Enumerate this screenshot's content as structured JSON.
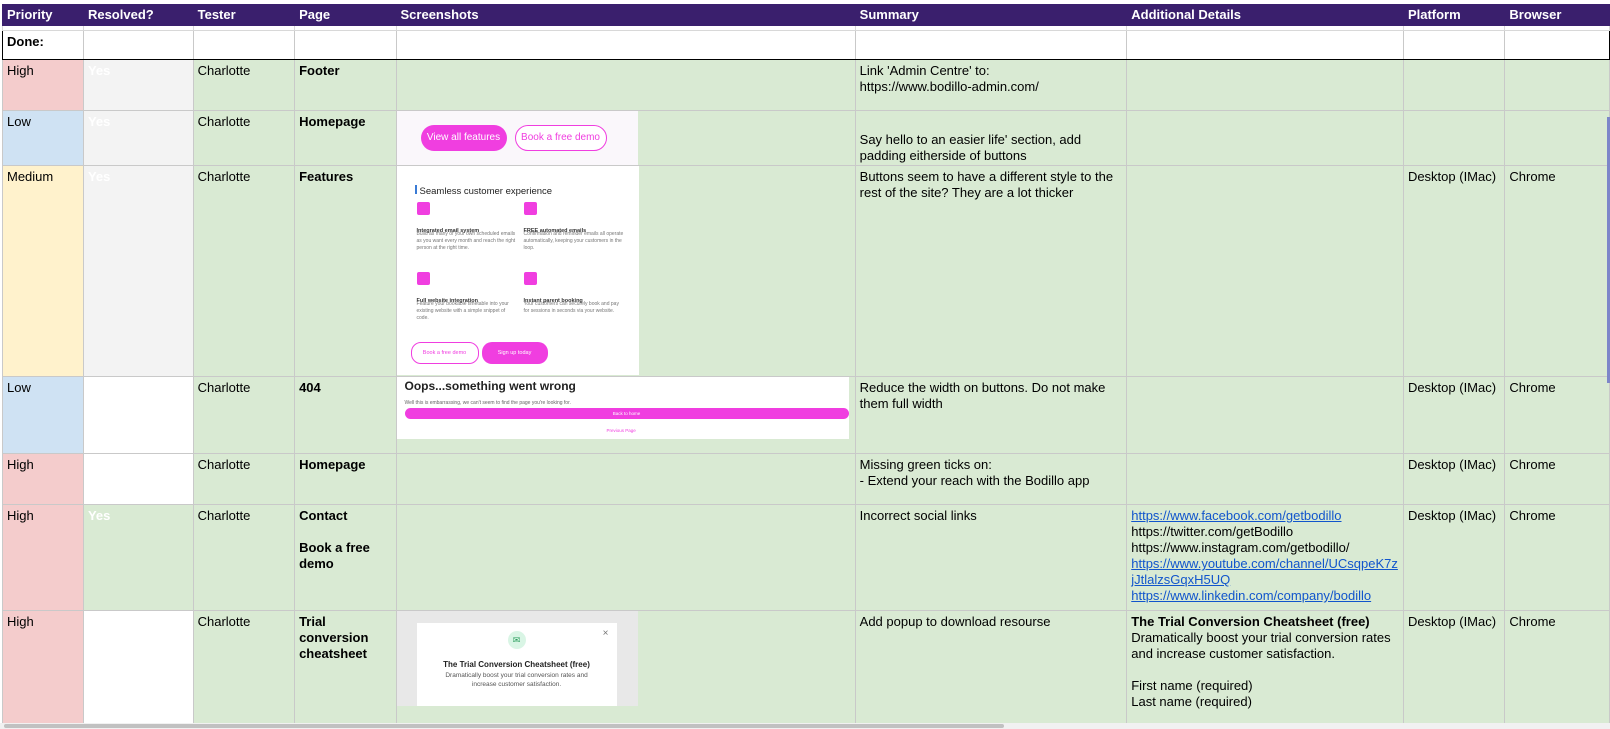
{
  "columns": [
    "Priority",
    "Resolved?",
    "Tester",
    "Page",
    "Screenshots",
    "Summary",
    "Additional Details",
    "Platform",
    "Browser"
  ],
  "done_label": "Done:",
  "colors": {
    "header_bg": "#3a1f6d",
    "row_green": "#d9ead3",
    "priority_high": "#f4cccc",
    "priority_low": "#cfe2f3",
    "priority_medium": "#fff2cc",
    "resolved_grey": "#f3f3f3",
    "link": "#1155cc",
    "brand_pink": "#f03ee0"
  },
  "rows": [
    {
      "priority": "High",
      "resolved": "Yes",
      "tester": "Charlotte",
      "page": "Footer",
      "summary": "Link 'Admin Centre' to:\nhttps://www.bodillo-admin.com/",
      "platform": "",
      "browser": ""
    },
    {
      "priority": "Low",
      "resolved": "Yes",
      "tester": "Charlotte",
      "page": "Homepage",
      "screenshot": {
        "btn_primary": "View all features",
        "btn_secondary": "Book a free demo"
      },
      "summary": "Say hello to an easier life' section, add padding eitherside of buttons",
      "platform": "",
      "browser": ""
    },
    {
      "priority": "Medium",
      "resolved": "Yes",
      "tester": "Charlotte",
      "page": "Features",
      "screenshot": {
        "title": "Seamless customer experience",
        "f1_title": "Integrated email system",
        "f1_text": "Build as many of your own scheduled emails as you want every month and reach the right person at the right time.",
        "f2_title": "FREE automated emails",
        "f2_text": "Confirmation and reminder emails all operate automatically, keeping your customers in the loop.",
        "f3_title": "Full website integration",
        "f3_text": "Feature your bookable timetable into your existing website with a simple snippet of code.",
        "f4_title": "Instant parent booking",
        "f4_text": "Your customers can securely book and pay for sessions in seconds via your website.",
        "btn_secondary": "Book a free demo",
        "btn_primary": "Sign up today"
      },
      "summary": "Buttons seem to have a different style to the rest of the site? They are a lot thicker",
      "platform": "Desktop (IMac)",
      "browser": "Chrome"
    },
    {
      "priority": "Low",
      "resolved": "",
      "tester": "Charlotte",
      "page": "404",
      "screenshot": {
        "title": "Oops...something went wrong",
        "text": "Well this is embarrassing, we can't seem to find the page you're looking for.",
        "btn_primary": "Back to home",
        "link": "Previous Page"
      },
      "summary": "Reduce the width on buttons. Do not make them full width",
      "platform": "Desktop (IMac)",
      "browser": "Chrome"
    },
    {
      "priority": "High",
      "resolved": "",
      "tester": "Charlotte",
      "page": "Homepage",
      "summary": "Missing green ticks on:\n- Extend your reach with the Bodillo app",
      "platform": "Desktop (IMac)",
      "browser": "Chrome"
    },
    {
      "priority": "High",
      "resolved": "Yes",
      "tester": "Charlotte",
      "page_line1": "Contact",
      "page_line2": "Book a free demo",
      "summary": "Incorrect social links",
      "links": [
        {
          "text": "https://www.facebook.com/getbodillo",
          "linked": true
        },
        {
          "text": "https://twitter.com/getBodillo",
          "linked": false
        },
        {
          "text": "https://www.instagram.com/getbodillo/",
          "linked": false
        },
        {
          "text": "https://www.youtube.com/channel/UCsqpeK7zjJtlalzsGqxH5UQ",
          "linked": true
        },
        {
          "text": "https://www.linkedin.com/company/bodillo",
          "linked": true
        }
      ],
      "platform": "Desktop (IMac)",
      "browser": "Chrome"
    },
    {
      "priority": "High",
      "resolved": "",
      "tester": "Charlotte",
      "page": "Trial conversion cheatsheet",
      "screenshot": {
        "title": "The Trial Conversion Cheatsheet (free)",
        "text": "Dramatically boost your trial conversion rates and increase customer satisfaction.",
        "close": "×"
      },
      "summary": "Add popup to download resourse",
      "details_title": "The Trial Conversion Cheatsheet (free)",
      "details_text": "Dramatically boost your trial conversion rates and increase customer satisfaction.",
      "details_field1": "First name (required)",
      "details_field2": "Last name (required)",
      "platform": "Desktop (IMac)",
      "browser": "Chrome"
    }
  ]
}
